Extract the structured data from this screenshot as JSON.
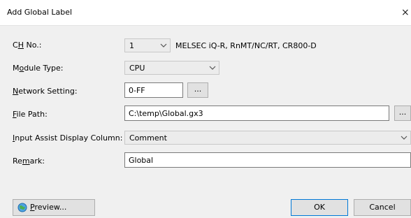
{
  "window": {
    "title": "Add Global Label",
    "close_glyph": "×"
  },
  "form": {
    "ch_no": {
      "label_prefix": "C",
      "label_mnemonic": "H",
      "label_suffix": " No.:",
      "value": "1",
      "info": "MELSEC iQ-R, RnMT/NC/RT, CR800-D"
    },
    "module_type": {
      "label_prefix": "M",
      "label_mnemonic": "o",
      "label_suffix": "dule Type:",
      "value": "CPU"
    },
    "network_setting": {
      "label_prefix": "",
      "label_mnemonic": "N",
      "label_suffix": "etwork Setting:",
      "value": "0-FF",
      "browse_label": "..."
    },
    "file_path": {
      "label_prefix": "",
      "label_mnemonic": "F",
      "label_suffix": "ile Path:",
      "value": "C:\\temp\\Global.gx3",
      "browse_label": "..."
    },
    "input_assist": {
      "label_prefix": "",
      "label_mnemonic": "I",
      "label_suffix": "nput Assist Display Column:",
      "value": "Comment"
    },
    "remark": {
      "label_prefix": "Re",
      "label_mnemonic": "m",
      "label_suffix": "ark:",
      "value": "Global"
    }
  },
  "buttons": {
    "preview_prefix": "",
    "preview_mnemonic": "P",
    "preview_suffix": "review...",
    "preview_icon": "preview-globe-icon",
    "ok": "OK",
    "cancel": "Cancel"
  },
  "colors": {
    "background": "#f0f0f0",
    "titlebar": "#ffffff",
    "default_button_border": "#0078d7"
  }
}
